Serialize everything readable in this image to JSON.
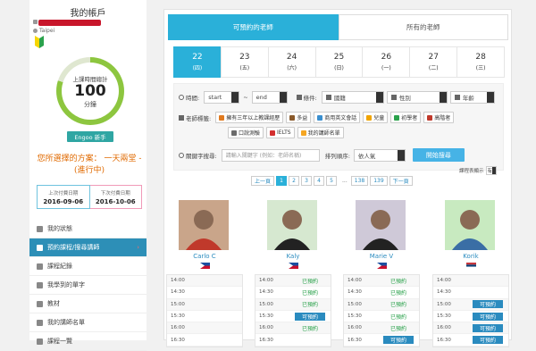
{
  "sidebar": {
    "title": "我的帳戶",
    "location": "Taipei",
    "gauge": {
      "label": "上課時間總計",
      "value": "100",
      "unit": "分鐘",
      "progress_percent": 80
    },
    "level_badge": "Engoo 新手",
    "plan": "您所選擇的方案： 一天兩堂 - (進行中)",
    "last_class": {
      "label": "上次付費日期",
      "value": "2016-09-06"
    },
    "next_class": {
      "label": "下次付費日期",
      "value": "2016-10-06"
    },
    "nav": [
      {
        "label": "我的狀態",
        "icon": "home-icon"
      },
      {
        "label": "預約課程/搜尋講師",
        "icon": "calendar-icon",
        "active": true
      },
      {
        "label": "課程紀錄",
        "icon": "list-icon"
      },
      {
        "label": "我學到的單字",
        "icon": "pencil-icon"
      },
      {
        "label": "教材",
        "icon": "book-icon"
      },
      {
        "label": "我的講師名單",
        "icon": "star-icon"
      },
      {
        "label": "課程一覽",
        "icon": "table-icon"
      }
    ]
  },
  "tabs": [
    "可預約的老師",
    "所有的老師"
  ],
  "days": [
    {
      "num": "22",
      "wd": "(四)"
    },
    {
      "num": "23",
      "wd": "(五)"
    },
    {
      "num": "24",
      "wd": "(六)"
    },
    {
      "num": "25",
      "wd": "(日)"
    },
    {
      "num": "26",
      "wd": "(一)"
    },
    {
      "num": "27",
      "wd": "(二)"
    },
    {
      "num": "28",
      "wd": "(三)"
    }
  ],
  "filters": {
    "time_label": "時間:",
    "start": "start",
    "tilde": "~",
    "end": "end",
    "cond_label": "條件:",
    "nationality": "國籍",
    "gender": "性別",
    "age": "年齡",
    "tags_label": "老師標籤:",
    "tags": [
      "擁有三年以上教課經歷",
      "多益",
      "商用英文會話",
      "兒童",
      "初學者",
      "高階者",
      "口說測驗",
      "IELTS",
      "我的講師名單"
    ],
    "keyword_label": "關鍵字搜尋:",
    "keyword_placeholder": "請輸入關鍵字 (例如：老師名稱)",
    "sort_label": "排列順序:",
    "sort_value": "依人氣",
    "search_button": "開始搜尋",
    "per_page_label": "課程表顯示",
    "per_page_value": "有"
  },
  "pager": {
    "prev": "上一頁",
    "pages": [
      "1",
      "2",
      "3",
      "4",
      "5"
    ],
    "ellipsis": "...",
    "tail": [
      "138",
      "139"
    ],
    "next": "下一頁"
  },
  "teachers": [
    {
      "name": "Carlo C",
      "flag": "ph",
      "slots": [
        [
          "14:00",
          ""
        ],
        [
          "14:30",
          ""
        ],
        [
          "15:00",
          ""
        ],
        [
          "15:30",
          ""
        ],
        [
          "16:00",
          ""
        ],
        [
          "16:30",
          ""
        ]
      ]
    },
    {
      "name": "Kaly",
      "flag": "ph",
      "slots": [
        [
          "14:00",
          "已預約"
        ],
        [
          "14:30",
          "已預約"
        ],
        [
          "15:00",
          "已預約"
        ],
        [
          "15:30",
          "可預約"
        ],
        [
          "16:00",
          "已預約"
        ],
        [
          "16:30",
          ""
        ]
      ]
    },
    {
      "name": "Marie V",
      "flag": "ph",
      "slots": [
        [
          "14:00",
          "已預約"
        ],
        [
          "14:30",
          "已預約"
        ],
        [
          "15:00",
          "已預約"
        ],
        [
          "15:30",
          "已預約"
        ],
        [
          "16:00",
          "已預約"
        ],
        [
          "16:30",
          "可預約"
        ]
      ]
    },
    {
      "name": "Korik",
      "flag": "rs",
      "slots": [
        [
          "14:00",
          ""
        ],
        [
          "14:30",
          ""
        ],
        [
          "15:00",
          "可預約"
        ],
        [
          "15:30",
          "可預約"
        ],
        [
          "16:00",
          "可預約"
        ],
        [
          "16:30",
          "可預約"
        ]
      ]
    }
  ],
  "colors": {
    "accent": "#2ab0d9",
    "booked": "#2ba24c",
    "open": "#2a8bbf",
    "plan": "#e06a00"
  }
}
